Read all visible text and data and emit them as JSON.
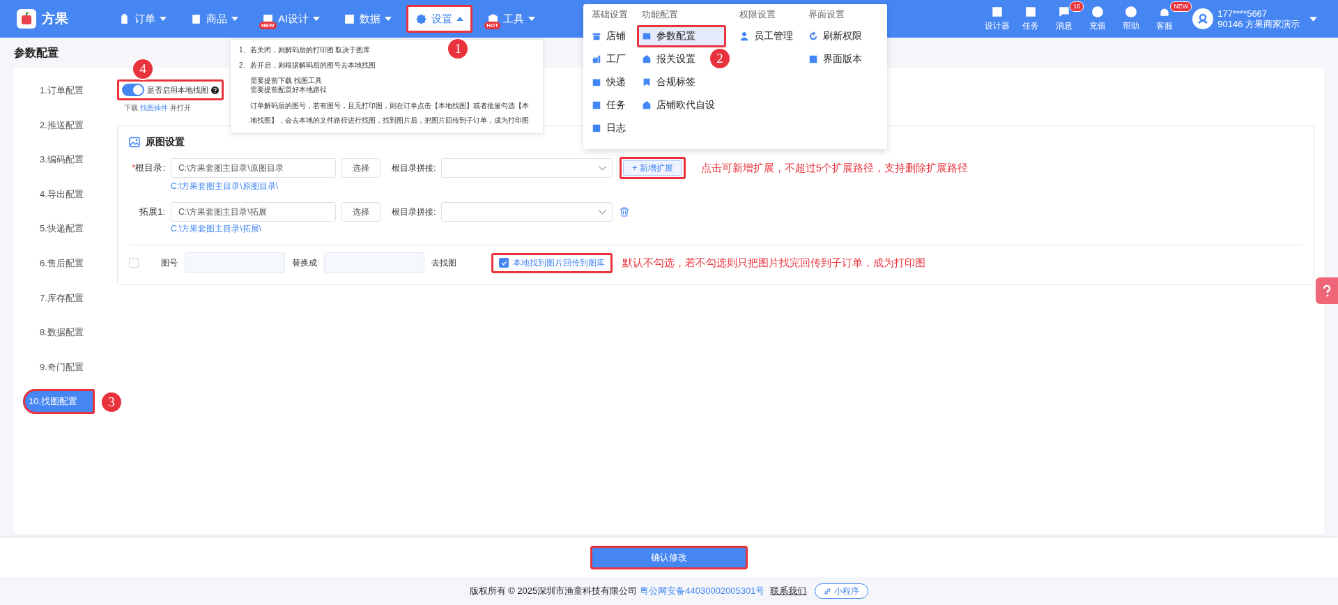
{
  "header": {
    "logo": "方果",
    "nav": [
      {
        "label": "订单",
        "expanded": false,
        "highlighted": false
      },
      {
        "label": "商品",
        "expanded": false,
        "highlighted": false
      },
      {
        "label": "AI设计",
        "badge": "NEW",
        "expanded": false,
        "highlighted": false
      },
      {
        "label": "数据",
        "expanded": false,
        "highlighted": false
      },
      {
        "label": "设置",
        "expanded": true,
        "highlighted": true,
        "marker": "1"
      },
      {
        "label": "工具",
        "badge": "HOT",
        "expanded": false,
        "highlighted": false
      }
    ],
    "tools": [
      {
        "label": "设计器"
      },
      {
        "label": "任务"
      },
      {
        "label": "消息",
        "badge": "16"
      },
      {
        "label": "充值"
      },
      {
        "label": "帮助"
      },
      {
        "label": "客服",
        "badge": "NEW"
      }
    ],
    "user": {
      "phone": "177****5667",
      "name": "90146 方果商家演示"
    }
  },
  "menu": {
    "columns": [
      {
        "heading": "基础设置",
        "items": [
          {
            "label": "店铺",
            "selected": false
          },
          {
            "label": "工厂",
            "selected": false
          },
          {
            "label": "快递",
            "selected": false
          },
          {
            "label": "任务",
            "selected": false
          },
          {
            "label": "日志",
            "selected": false
          }
        ]
      },
      {
        "heading": "功能配置",
        "items": [
          {
            "label": "参数配置",
            "selected": true,
            "marker": "2"
          },
          {
            "label": "报关设置",
            "selected": false
          },
          {
            "label": "合规标签",
            "selected": false
          },
          {
            "label": "店铺欧代自设",
            "selected": false
          }
        ]
      },
      {
        "heading": "权限设置",
        "items": [
          {
            "label": "员工管理",
            "selected": false
          }
        ]
      },
      {
        "heading": "界面设置",
        "items": [
          {
            "label": "刷新权限",
            "selected": false
          },
          {
            "label": "界面版本",
            "selected": false
          }
        ]
      }
    ]
  },
  "tooltip": [
    {
      "kind": "item",
      "text": "1、若关闭，则解码后的打印图 取决于图库"
    },
    {
      "kind": "item",
      "text": "2、若开启，则根据解码后的图号去本地找图"
    },
    {
      "kind": "sub",
      "text": "需要提前下载 找图工具"
    },
    {
      "kind": "sub",
      "text": "需要提前配置好本地路径"
    },
    {
      "kind": "para",
      "text": "订单解码后的图号，若有图号，且无打印图，则在订单点击【本地找图】或者批量勾选【本地找图】，会去本地的文件路径进行找图，找到图片后，把图片回传到子订单，成为打印图"
    }
  ],
  "page_title": "参数配置",
  "sidebar": [
    {
      "label": "1.订单配置",
      "selected": false
    },
    {
      "label": "2.推送配置",
      "selected": false
    },
    {
      "label": "3.编码配置",
      "selected": false
    },
    {
      "label": "4.导出配置",
      "selected": false
    },
    {
      "label": "5.快递配置",
      "selected": false
    },
    {
      "label": "6.售后配置",
      "selected": false
    },
    {
      "label": "7.库存配置",
      "selected": false
    },
    {
      "label": "8.数据配置",
      "selected": false
    },
    {
      "label": "9.奇门配置",
      "selected": false
    },
    {
      "label": "10.找图配置",
      "selected": true,
      "marker": "3"
    }
  ],
  "toggle": {
    "label": "是否启用本地找图",
    "on": true,
    "highlighted": true,
    "marker": "4"
  },
  "download_hint": {
    "before": "下载",
    "link": "找图插件",
    "after": "并打开"
  },
  "card": {
    "title": "原图设置",
    "rows": [
      {
        "required_mark": "*",
        "label": "根目录:",
        "value": "C:\\方果套图主目录\\原图目录",
        "button": "选择",
        "join_label": "根目录拼接:",
        "path": "C:\\方果套图主目录\\原图目录\\",
        "action": {
          "kind": "add",
          "label": "+ 新增扩展",
          "highlighted": true
        },
        "note": "点击可新增扩展，不超过5个扩展路径，支持删除扩展路径"
      },
      {
        "label": "拓展1:",
        "value": "C:\\方果套图主目录\\拓展",
        "button": "选择",
        "join_label": "根目录拼接:",
        "path": "C:\\方果套图主目录\\拓展\\",
        "action": {
          "kind": "delete"
        }
      }
    ],
    "replace": {
      "checked": false,
      "label": "图号",
      "middle": "替换成",
      "end": "去找图",
      "option": {
        "label": "本地找到图片回传到图库",
        "checked": true,
        "highlighted": true
      },
      "note": "默认不勾选，若不勾选则只把图片找完回传到子订单，成为打印图"
    }
  },
  "confirm": "确认修改",
  "footer": {
    "text": "版权所有 © 2025深圳市渔童科技有限公司",
    "license": "粤公网安备44030002005301号",
    "contact": "联系我们",
    "mini": "小程序"
  }
}
